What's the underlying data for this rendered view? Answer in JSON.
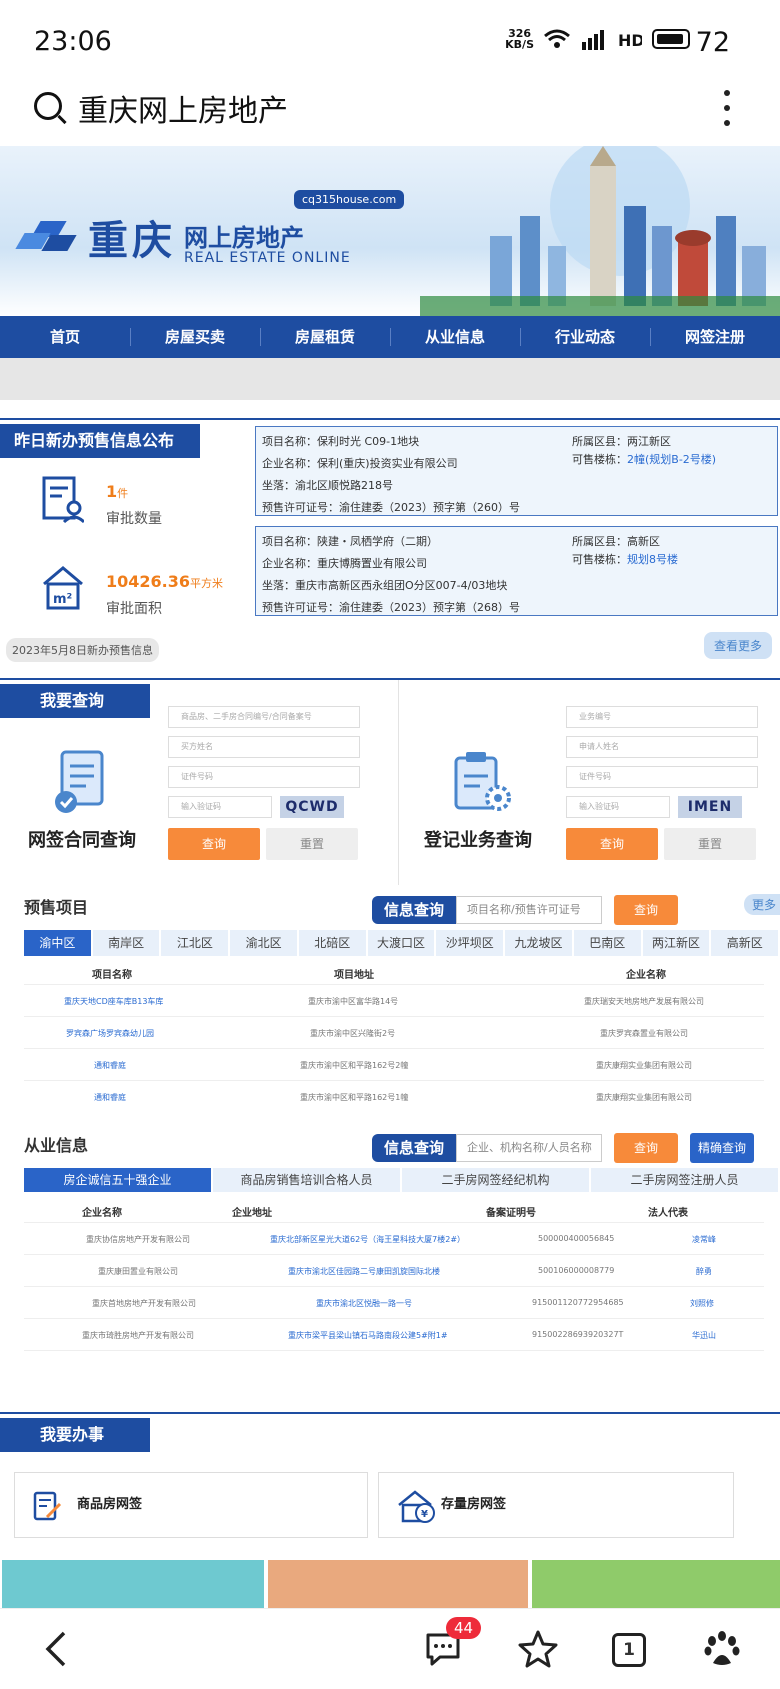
{
  "status": {
    "time": "23:06",
    "speed_value": "326",
    "speed_unit": "KB/S",
    "battery": "72"
  },
  "browser": {
    "query": "重庆网上房地产"
  },
  "site": {
    "logo_title": "重庆",
    "logo_sub": "网上房地产",
    "logo_en": "REAL ESTATE ONLINE",
    "domain": "cq315house.com"
  },
  "nav": [
    "首页",
    "房屋买卖",
    "房屋租赁",
    "从业信息",
    "行业动态",
    "网签注册"
  ],
  "presale": {
    "title": "昨日新办预售信息公布",
    "count_value": "1",
    "count_unit": "件",
    "count_label": "审批数量",
    "area_value": "10426.36",
    "area_unit": "平方米",
    "area_label": "审批面积",
    "date_note": "2023年5月8日新办预售信息",
    "more": "查看更多",
    "items": [
      {
        "project": "项目名称：保利时光 C09-1地块",
        "company": "企业名称：保利(重庆)投资实业有限公司",
        "location": "坐落：渝北区顺悦路218号",
        "permit": "预售许可证号：渝住建委（2023）预字第（260）号",
        "district": "所属区县：两江新区",
        "building_label": "可售楼栋：",
        "building": "2幢(规划B-2号楼)"
      },
      {
        "project": "项目名称：陕建・凤栖学府（二期）",
        "company": "企业名称：重庆博腾置业有限公司",
        "location": "坐落：重庆市高新区西永组团O分区007-4/03地块",
        "permit": "预售许可证号：渝住建委（2023）预字第（268）号",
        "district": "所属区县：高新区",
        "building_label": "可售楼栋：",
        "building": "规划8号楼"
      }
    ]
  },
  "query": {
    "title": "我要查询",
    "contract": {
      "label": "网签合同查询",
      "fields": [
        "商品房、二手房合同编号/合同备案号",
        "买方姓名",
        "证件号码",
        "输入验证码"
      ],
      "captcha": "QCWD",
      "submit": "查询",
      "reset": "重置"
    },
    "registration": {
      "label": "登记业务查询",
      "fields": [
        "业务编号",
        "申请人姓名",
        "证件号码",
        "输入验证码"
      ],
      "captcha": "IMEN",
      "submit": "查询",
      "reset": "重置"
    }
  },
  "projects": {
    "title": "预售项目",
    "search_tab": "信息查询",
    "search_placeholder": "项目名称/预售许可证号",
    "search_btn": "查询",
    "more": "更多",
    "districts": [
      "渝中区",
      "南岸区",
      "江北区",
      "渝北区",
      "北碚区",
      "大渡口区",
      "沙坪坝区",
      "九龙坡区",
      "巴南区",
      "两江新区",
      "高新区"
    ],
    "headers": [
      "项目名称",
      "项目地址",
      "企业名称"
    ],
    "rows": [
      [
        "重庆天地CD座车库B13车库",
        "重庆市渝中区富华路14号",
        "重庆瑞安天地房地产发展有限公司"
      ],
      [
        "罗宾森广场罗宾森幼儿园",
        "重庆市渝中区兴隆街2号",
        "重庆罗宾森置业有限公司"
      ],
      [
        "通和睿庭",
        "重庆市渝中区和平路162号2幢",
        "重庆康翔实业集团有限公司"
      ],
      [
        "通和睿庭",
        "重庆市渝中区和平路162号1幢",
        "重庆康翔实业集团有限公司"
      ]
    ]
  },
  "employees": {
    "title": "从业信息",
    "search_tab": "信息查询",
    "search_placeholder": "企业、机构名称/人员名称",
    "search_btn": "查询",
    "precise_btn": "精确查询",
    "tabs": [
      "房企诚信五十强企业",
      "商品房销售培训合格人员",
      "二手房网签经纪机构",
      "二手房网签注册人员"
    ],
    "headers": [
      "企业名称",
      "企业地址",
      "备案证明号",
      "法人代表"
    ],
    "rows": [
      [
        "重庆协信房地产开发有限公司",
        "重庆北部新区星光大道62号（海王星科技大厦7楼2#）",
        "500000400056845",
        "凌常峰"
      ],
      [
        "重庆康田置业有限公司",
        "重庆市渝北区佳园路二号康田凯旋国际北楼",
        "500106000008779",
        "醉勇"
      ],
      [
        "重庆首地房地产开发有限公司",
        "重庆市渝北区悦融一路一号",
        "915001120772954685",
        "刘照修"
      ],
      [
        "重庆市琦胜房地产开发有限公司",
        "重庆市梁平县梁山镇石马路南段公建5#附1#",
        "91500228693920327T",
        "华迅山"
      ]
    ]
  },
  "business": {
    "title": "我要办事",
    "cards": [
      "商品房网签",
      "存量房网签"
    ]
  },
  "tabs_count": "1",
  "message_badge": "44",
  "colors": {
    "primary": "#1e4da1",
    "accent": "#f78a3a",
    "link": "#2a6bd1"
  }
}
